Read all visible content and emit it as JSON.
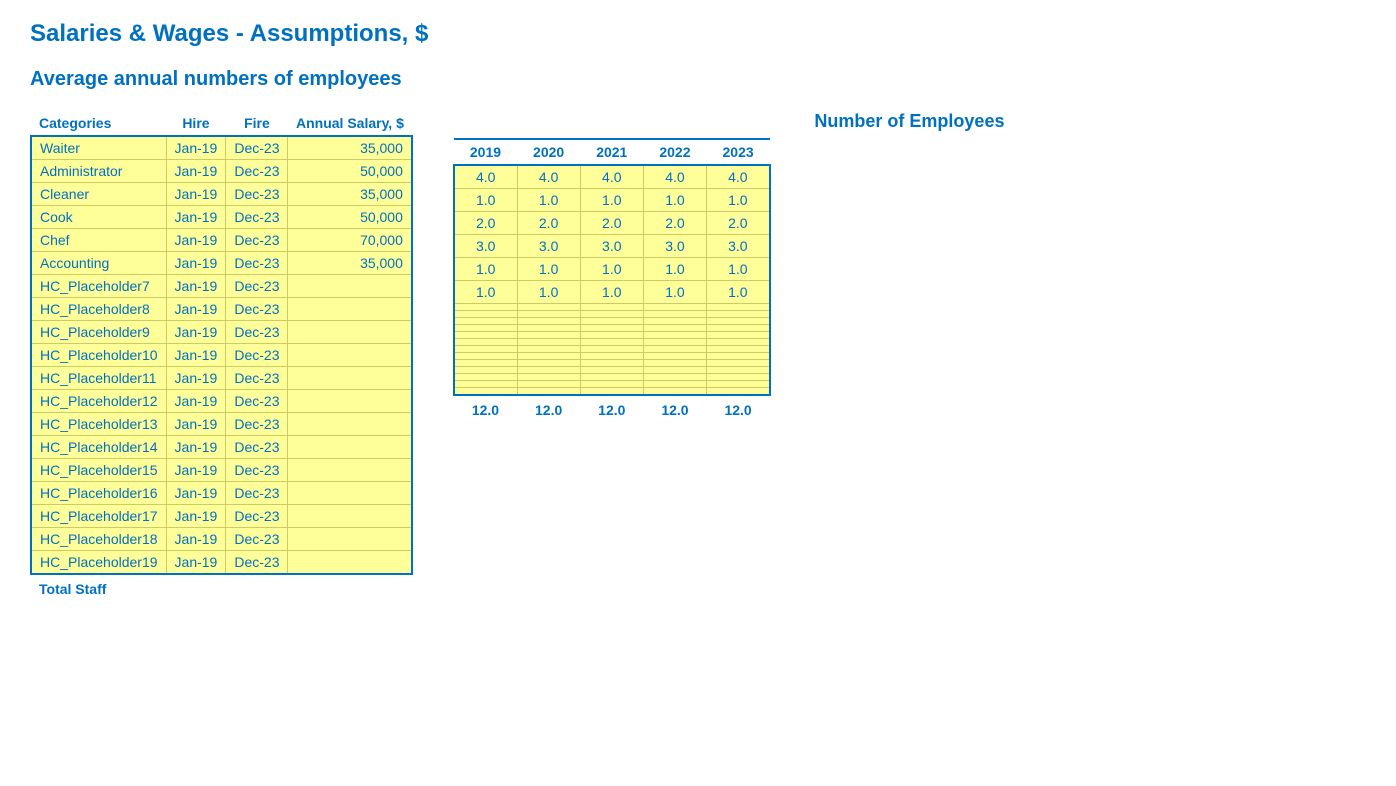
{
  "page": {
    "title": "Salaries & Wages - Assumptions, $",
    "subtitle": "Average annual numbers of employees"
  },
  "left_table": {
    "headers": {
      "category": "Categories",
      "hire": "Hire",
      "fire": "Fire",
      "salary": "Annual Salary, $"
    },
    "rows": [
      {
        "category": "Waiter",
        "hire": "Jan-19",
        "fire": "Dec-23",
        "salary": "35,000"
      },
      {
        "category": "Administrator",
        "hire": "Jan-19",
        "fire": "Dec-23",
        "salary": "50,000"
      },
      {
        "category": "Cleaner",
        "hire": "Jan-19",
        "fire": "Dec-23",
        "salary": "35,000"
      },
      {
        "category": "Cook",
        "hire": "Jan-19",
        "fire": "Dec-23",
        "salary": "50,000"
      },
      {
        "category": "Chef",
        "hire": "Jan-19",
        "fire": "Dec-23",
        "salary": "70,000"
      },
      {
        "category": "Accounting",
        "hire": "Jan-19",
        "fire": "Dec-23",
        "salary": "35,000"
      },
      {
        "category": "HC_Placeholder7",
        "hire": "Jan-19",
        "fire": "Dec-23",
        "salary": ""
      },
      {
        "category": "HC_Placeholder8",
        "hire": "Jan-19",
        "fire": "Dec-23",
        "salary": ""
      },
      {
        "category": "HC_Placeholder9",
        "hire": "Jan-19",
        "fire": "Dec-23",
        "salary": ""
      },
      {
        "category": "HC_Placeholder10",
        "hire": "Jan-19",
        "fire": "Dec-23",
        "salary": ""
      },
      {
        "category": "HC_Placeholder11",
        "hire": "Jan-19",
        "fire": "Dec-23",
        "salary": ""
      },
      {
        "category": "HC_Placeholder12",
        "hire": "Jan-19",
        "fire": "Dec-23",
        "salary": ""
      },
      {
        "category": "HC_Placeholder13",
        "hire": "Jan-19",
        "fire": "Dec-23",
        "salary": ""
      },
      {
        "category": "HC_Placeholder14",
        "hire": "Jan-19",
        "fire": "Dec-23",
        "salary": ""
      },
      {
        "category": "HC_Placeholder15",
        "hire": "Jan-19",
        "fire": "Dec-23",
        "salary": ""
      },
      {
        "category": "HC_Placeholder16",
        "hire": "Jan-19",
        "fire": "Dec-23",
        "salary": ""
      },
      {
        "category": "HC_Placeholder17",
        "hire": "Jan-19",
        "fire": "Dec-23",
        "salary": ""
      },
      {
        "category": "HC_Placeholder18",
        "hire": "Jan-19",
        "fire": "Dec-23",
        "salary": ""
      },
      {
        "category": "HC_Placeholder19",
        "hire": "Jan-19",
        "fire": "Dec-23",
        "salary": ""
      }
    ],
    "footer": {
      "label": "Total Staff"
    }
  },
  "right_table": {
    "title": "Number of Employees",
    "headers": [
      "2019",
      "2020",
      "2021",
      "2022",
      "2023"
    ],
    "rows": [
      [
        "4.0",
        "4.0",
        "4.0",
        "4.0",
        "4.0"
      ],
      [
        "1.0",
        "1.0",
        "1.0",
        "1.0",
        "1.0"
      ],
      [
        "2.0",
        "2.0",
        "2.0",
        "2.0",
        "2.0"
      ],
      [
        "3.0",
        "3.0",
        "3.0",
        "3.0",
        "3.0"
      ],
      [
        "1.0",
        "1.0",
        "1.0",
        "1.0",
        "1.0"
      ],
      [
        "1.0",
        "1.0",
        "1.0",
        "1.0",
        "1.0"
      ],
      [
        "",
        "",
        "",
        "",
        ""
      ],
      [
        "",
        "",
        "",
        "",
        ""
      ],
      [
        "",
        "",
        "",
        "",
        ""
      ],
      [
        "",
        "",
        "",
        "",
        ""
      ],
      [
        "",
        "",
        "",
        "",
        ""
      ],
      [
        "",
        "",
        "",
        "",
        ""
      ],
      [
        "",
        "",
        "",
        "",
        ""
      ],
      [
        "",
        "",
        "",
        "",
        ""
      ],
      [
        "",
        "",
        "",
        "",
        ""
      ],
      [
        "",
        "",
        "",
        "",
        ""
      ],
      [
        "",
        "",
        "",
        "",
        ""
      ],
      [
        "",
        "",
        "",
        "",
        ""
      ],
      [
        "",
        "",
        "",
        "",
        ""
      ]
    ],
    "footer": [
      "12.0",
      "12.0",
      "12.0",
      "12.0",
      "12.0"
    ]
  }
}
